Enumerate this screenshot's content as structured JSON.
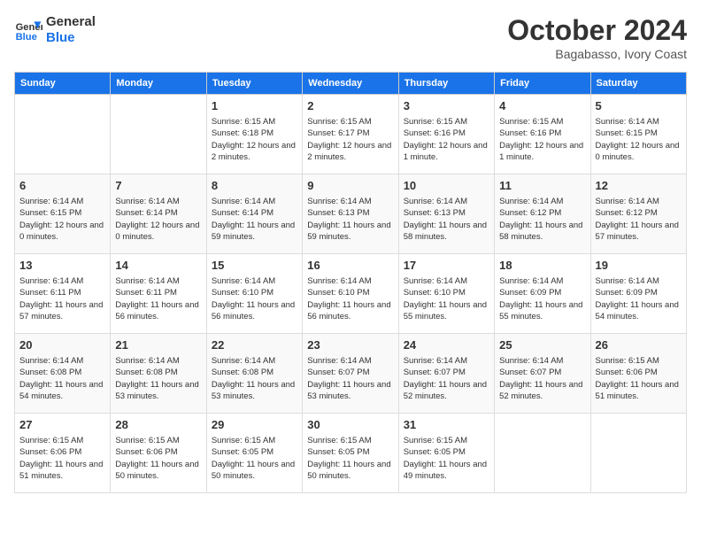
{
  "logo": {
    "line1": "General",
    "line2": "Blue"
  },
  "title": "October 2024",
  "subtitle": "Bagabasso, Ivory Coast",
  "days_header": [
    "Sunday",
    "Monday",
    "Tuesday",
    "Wednesday",
    "Thursday",
    "Friday",
    "Saturday"
  ],
  "weeks": [
    [
      {
        "day": "",
        "info": ""
      },
      {
        "day": "",
        "info": ""
      },
      {
        "day": "1",
        "info": "Sunrise: 6:15 AM\nSunset: 6:18 PM\nDaylight: 12 hours and 2 minutes."
      },
      {
        "day": "2",
        "info": "Sunrise: 6:15 AM\nSunset: 6:17 PM\nDaylight: 12 hours and 2 minutes."
      },
      {
        "day": "3",
        "info": "Sunrise: 6:15 AM\nSunset: 6:16 PM\nDaylight: 12 hours and 1 minute."
      },
      {
        "day": "4",
        "info": "Sunrise: 6:15 AM\nSunset: 6:16 PM\nDaylight: 12 hours and 1 minute."
      },
      {
        "day": "5",
        "info": "Sunrise: 6:14 AM\nSunset: 6:15 PM\nDaylight: 12 hours and 0 minutes."
      }
    ],
    [
      {
        "day": "6",
        "info": "Sunrise: 6:14 AM\nSunset: 6:15 PM\nDaylight: 12 hours and 0 minutes."
      },
      {
        "day": "7",
        "info": "Sunrise: 6:14 AM\nSunset: 6:14 PM\nDaylight: 12 hours and 0 minutes."
      },
      {
        "day": "8",
        "info": "Sunrise: 6:14 AM\nSunset: 6:14 PM\nDaylight: 11 hours and 59 minutes."
      },
      {
        "day": "9",
        "info": "Sunrise: 6:14 AM\nSunset: 6:13 PM\nDaylight: 11 hours and 59 minutes."
      },
      {
        "day": "10",
        "info": "Sunrise: 6:14 AM\nSunset: 6:13 PM\nDaylight: 11 hours and 58 minutes."
      },
      {
        "day": "11",
        "info": "Sunrise: 6:14 AM\nSunset: 6:12 PM\nDaylight: 11 hours and 58 minutes."
      },
      {
        "day": "12",
        "info": "Sunrise: 6:14 AM\nSunset: 6:12 PM\nDaylight: 11 hours and 57 minutes."
      }
    ],
    [
      {
        "day": "13",
        "info": "Sunrise: 6:14 AM\nSunset: 6:11 PM\nDaylight: 11 hours and 57 minutes."
      },
      {
        "day": "14",
        "info": "Sunrise: 6:14 AM\nSunset: 6:11 PM\nDaylight: 11 hours and 56 minutes."
      },
      {
        "day": "15",
        "info": "Sunrise: 6:14 AM\nSunset: 6:10 PM\nDaylight: 11 hours and 56 minutes."
      },
      {
        "day": "16",
        "info": "Sunrise: 6:14 AM\nSunset: 6:10 PM\nDaylight: 11 hours and 56 minutes."
      },
      {
        "day": "17",
        "info": "Sunrise: 6:14 AM\nSunset: 6:10 PM\nDaylight: 11 hours and 55 minutes."
      },
      {
        "day": "18",
        "info": "Sunrise: 6:14 AM\nSunset: 6:09 PM\nDaylight: 11 hours and 55 minutes."
      },
      {
        "day": "19",
        "info": "Sunrise: 6:14 AM\nSunset: 6:09 PM\nDaylight: 11 hours and 54 minutes."
      }
    ],
    [
      {
        "day": "20",
        "info": "Sunrise: 6:14 AM\nSunset: 6:08 PM\nDaylight: 11 hours and 54 minutes."
      },
      {
        "day": "21",
        "info": "Sunrise: 6:14 AM\nSunset: 6:08 PM\nDaylight: 11 hours and 53 minutes."
      },
      {
        "day": "22",
        "info": "Sunrise: 6:14 AM\nSunset: 6:08 PM\nDaylight: 11 hours and 53 minutes."
      },
      {
        "day": "23",
        "info": "Sunrise: 6:14 AM\nSunset: 6:07 PM\nDaylight: 11 hours and 53 minutes."
      },
      {
        "day": "24",
        "info": "Sunrise: 6:14 AM\nSunset: 6:07 PM\nDaylight: 11 hours and 52 minutes."
      },
      {
        "day": "25",
        "info": "Sunrise: 6:14 AM\nSunset: 6:07 PM\nDaylight: 11 hours and 52 minutes."
      },
      {
        "day": "26",
        "info": "Sunrise: 6:15 AM\nSunset: 6:06 PM\nDaylight: 11 hours and 51 minutes."
      }
    ],
    [
      {
        "day": "27",
        "info": "Sunrise: 6:15 AM\nSunset: 6:06 PM\nDaylight: 11 hours and 51 minutes."
      },
      {
        "day": "28",
        "info": "Sunrise: 6:15 AM\nSunset: 6:06 PM\nDaylight: 11 hours and 50 minutes."
      },
      {
        "day": "29",
        "info": "Sunrise: 6:15 AM\nSunset: 6:05 PM\nDaylight: 11 hours and 50 minutes."
      },
      {
        "day": "30",
        "info": "Sunrise: 6:15 AM\nSunset: 6:05 PM\nDaylight: 11 hours and 50 minutes."
      },
      {
        "day": "31",
        "info": "Sunrise: 6:15 AM\nSunset: 6:05 PM\nDaylight: 11 hours and 49 minutes."
      },
      {
        "day": "",
        "info": ""
      },
      {
        "day": "",
        "info": ""
      }
    ]
  ]
}
